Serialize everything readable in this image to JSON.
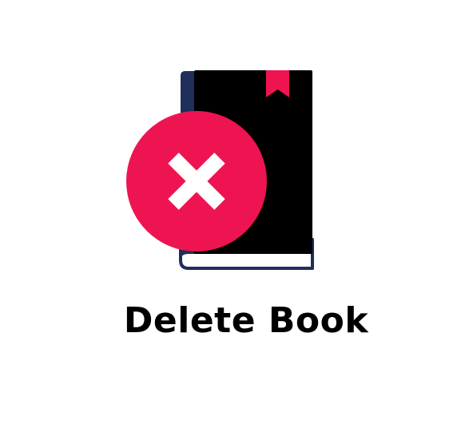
{
  "title": "Delete Book",
  "icon": {
    "name": "delete-book-icon",
    "parts": [
      "book-icon",
      "bookmark-icon",
      "close-icon"
    ]
  },
  "colors": {
    "book_cover": "#000000",
    "book_spine": "#1f2e5a",
    "page_edge_outline": "#1f2e5a",
    "page_edge_fill": "#ffffff",
    "bookmark": "#ee1451",
    "delete_circle": "#ee1451",
    "cross": "#ffffff",
    "text": "#000000"
  }
}
